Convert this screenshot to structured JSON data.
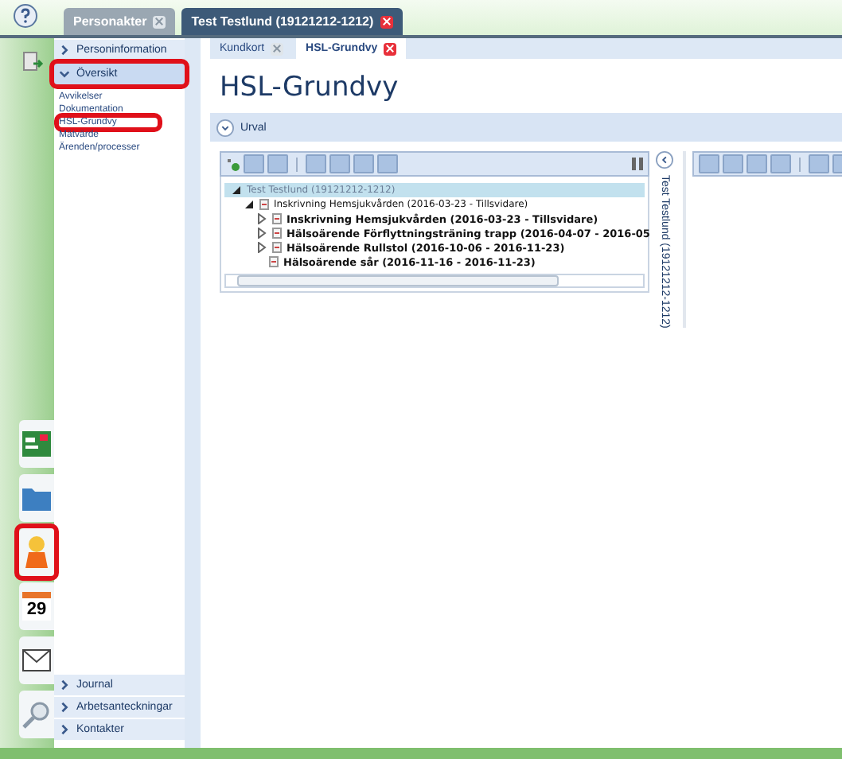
{
  "top_tabs": [
    {
      "label": "Personakter",
      "selected": false
    },
    {
      "label": "Test Testlund (19121212-1212)",
      "selected": true
    }
  ],
  "rail": [
    {
      "kind": "card",
      "highlighted": false
    },
    {
      "kind": "folder",
      "highlighted": false
    },
    {
      "kind": "person",
      "highlighted": true
    },
    {
      "kind": "calendar",
      "text": "29",
      "highlighted": false
    },
    {
      "kind": "envelope",
      "highlighted": false
    },
    {
      "kind": "magnifier",
      "highlighted": false
    }
  ],
  "sidebar": {
    "sections": [
      {
        "label": "Personinformation",
        "expanded": false,
        "highlighted": false
      },
      {
        "label": "Översikt",
        "expanded": true,
        "highlighted": true,
        "links": [
          {
            "label": "Avvikelser",
            "highlighted": false
          },
          {
            "label": "Dokumentation",
            "highlighted": false
          },
          {
            "label": "HSL-Grundvy",
            "highlighted": true
          },
          {
            "label": "Mätvärde",
            "highlighted": false
          },
          {
            "label": "Ärenden/processer",
            "highlighted": false
          }
        ]
      }
    ],
    "bottom_sections": [
      {
        "label": "Journal",
        "expanded": false
      },
      {
        "label": "Arbetsanteckningar",
        "expanded": false
      },
      {
        "label": "Kontakter",
        "expanded": false
      }
    ]
  },
  "main_tabs": [
    {
      "label": "Kundkort",
      "selected": false
    },
    {
      "label": "HSL-Grundvy",
      "selected": true
    }
  ],
  "page_title": "HSL-Grundvy",
  "filter": {
    "label": "Urval",
    "expanded": false
  },
  "tree": [
    {
      "label": "Test Testlund (19121212-1212)",
      "selected": true,
      "expanded": true,
      "children": [
        {
          "label": "Inskrivning Hemsjukvården (2016-03-23 - Tillsvidare)",
          "selected": false,
          "expanded": true,
          "children": [
            {
              "label": "Inskrivning Hemsjukvården (2016-03-23 - Tillsvidare)",
              "selected": false,
              "kind": "collapsed"
            },
            {
              "label": "Hälsoärende Förflyttningsträning trapp (2016-04-07 - 2016-05",
              "selected": false,
              "kind": "collapsed"
            },
            {
              "label": "Hälsoärende Rullstol (2016-10-06 - 2016-11-23)",
              "selected": false,
              "kind": "collapsed"
            },
            {
              "label": "Hälsoärende sår (2016-11-16 - 2016-11-23)",
              "selected": false,
              "kind": "leaf"
            }
          ]
        }
      ]
    }
  ],
  "side_panel": {
    "title": "Test Testlund (19121212-1212)"
  }
}
